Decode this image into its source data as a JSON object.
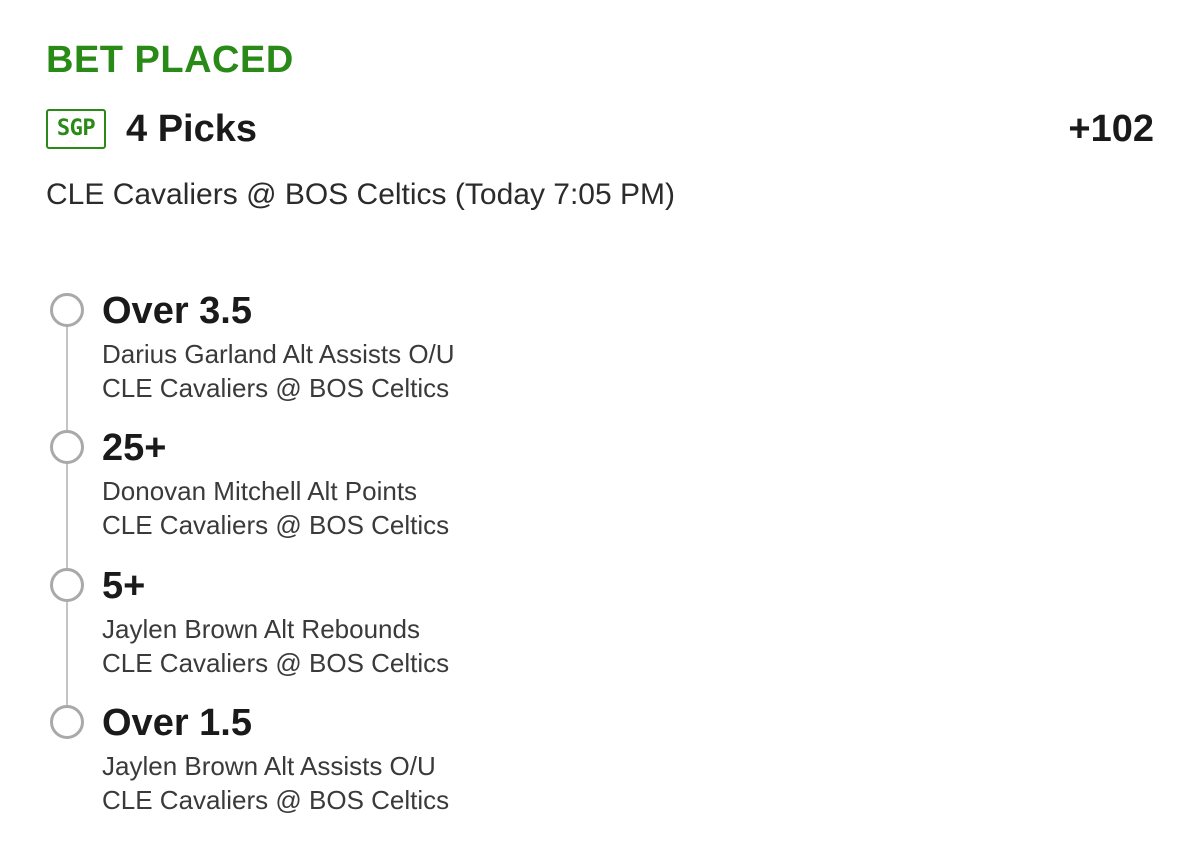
{
  "bet": {
    "status": "BET PLACED",
    "badge": "SGP",
    "picks_label": "4 Picks",
    "odds": "+102",
    "matchup": "CLE Cavaliers @ BOS Celtics (Today 7:05 PM)"
  },
  "colors": {
    "accent": "#2a8a17",
    "text": "#1a1a1a",
    "timeline": "#c4c4c4"
  },
  "legs": [
    {
      "selection": "Over 3.5",
      "market": "Darius Garland Alt Assists O/U",
      "game": "CLE Cavaliers @ BOS Celtics"
    },
    {
      "selection": "25+",
      "market": "Donovan Mitchell Alt Points",
      "game": "CLE Cavaliers @ BOS Celtics"
    },
    {
      "selection": "5+",
      "market": "Jaylen Brown Alt Rebounds",
      "game": "CLE Cavaliers @ BOS Celtics"
    },
    {
      "selection": "Over 1.5",
      "market": "Jaylen Brown Alt Assists O/U",
      "game": "CLE Cavaliers @ BOS Celtics"
    }
  ]
}
